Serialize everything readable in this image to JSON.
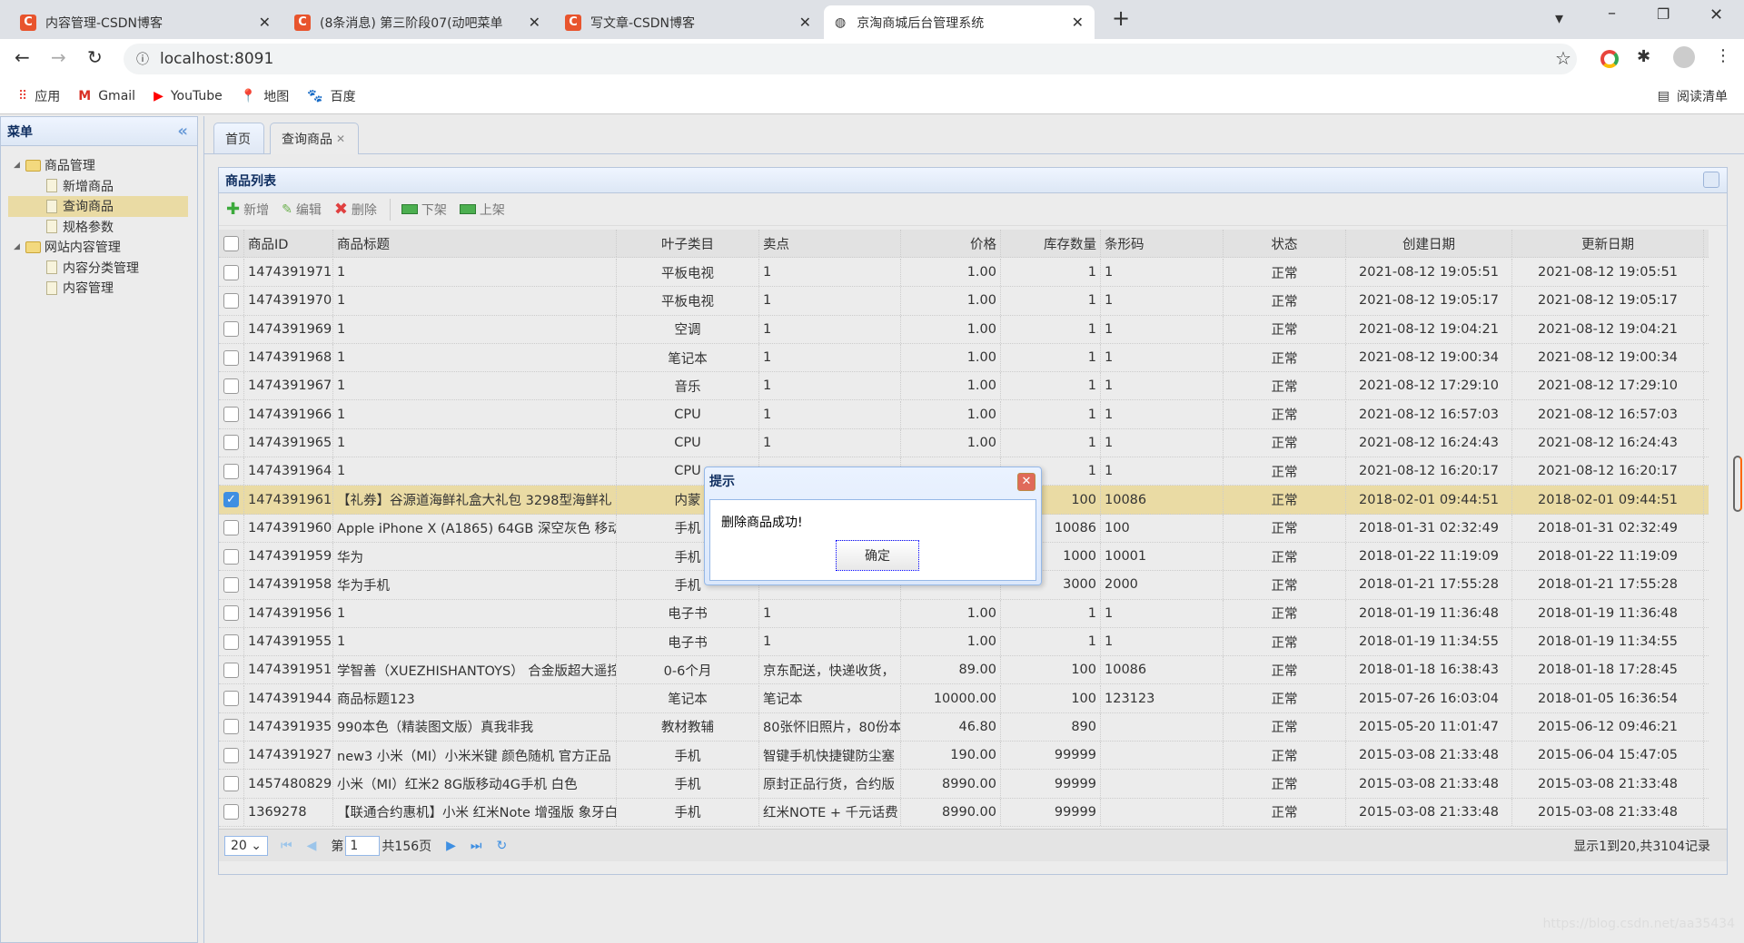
{
  "browser": {
    "tabs": [
      {
        "title": "内容管理-CSDN博客",
        "icon": "csdn-icon"
      },
      {
        "title": "(8条消息) 第三阶段07(动吧菜单",
        "icon": "csdn-icon"
      },
      {
        "title": "写文章-CSDN博客",
        "icon": "csdn-icon"
      },
      {
        "title": "京淘商城后台管理系统",
        "icon": "globe-icon"
      }
    ],
    "url": "localhost:8091",
    "bookmarks": [
      "应用",
      "Gmail",
      "YouTube",
      "地图",
      "百度"
    ],
    "reading_list": "阅读清单"
  },
  "sidebar": {
    "title": "菜单",
    "groups": [
      {
        "label": "商品管理",
        "items": [
          "新增商品",
          "查询商品",
          "规格参数"
        ]
      },
      {
        "label": "网站内容管理",
        "items": [
          "内容分类管理",
          "内容管理"
        ]
      }
    ],
    "selected": "查询商品"
  },
  "main_tabs": [
    "首页",
    "查询商品"
  ],
  "panel": {
    "title": "商品列表",
    "toolbar": [
      "新增",
      "编辑",
      "删除",
      "下架",
      "上架"
    ]
  },
  "grid": {
    "columns": [
      "商品ID",
      "商品标题",
      "叶子类目",
      "卖点",
      "价格",
      "库存数量",
      "条形码",
      "状态",
      "创建日期",
      "更新日期"
    ],
    "rows": [
      [
        "1474391971",
        "1",
        "平板电视",
        "1",
        "1.00",
        "1",
        "1",
        "正常",
        "2021-08-12 19:05:51",
        "2021-08-12 19:05:51"
      ],
      [
        "1474391970",
        "1",
        "平板电视",
        "1",
        "1.00",
        "1",
        "1",
        "正常",
        "2021-08-12 19:05:17",
        "2021-08-12 19:05:17"
      ],
      [
        "1474391969",
        "1",
        "空调",
        "1",
        "1.00",
        "1",
        "1",
        "正常",
        "2021-08-12 19:04:21",
        "2021-08-12 19:04:21"
      ],
      [
        "1474391968",
        "1",
        "笔记本",
        "1",
        "1.00",
        "1",
        "1",
        "正常",
        "2021-08-12 19:00:34",
        "2021-08-12 19:00:34"
      ],
      [
        "1474391967",
        "1",
        "音乐",
        "1",
        "1.00",
        "1",
        "1",
        "正常",
        "2021-08-12 17:29:10",
        "2021-08-12 17:29:10"
      ],
      [
        "1474391966",
        "1",
        "CPU",
        "1",
        "1.00",
        "1",
        "1",
        "正常",
        "2021-08-12 16:57:03",
        "2021-08-12 16:57:03"
      ],
      [
        "1474391965",
        "1",
        "CPU",
        "1",
        "1.00",
        "1",
        "1",
        "正常",
        "2021-08-12 16:24:43",
        "2021-08-12 16:24:43"
      ],
      [
        "1474391964",
        "1",
        "CPU",
        "",
        "",
        "1",
        "1",
        "正常",
        "2021-08-12 16:20:17",
        "2021-08-12 16:20:17"
      ],
      [
        "1474391961",
        "【礼券】谷源道海鲜礼盒大礼包 3298型海鲜礼",
        "内蒙",
        "",
        "",
        "100",
        "10086",
        "正常",
        "2018-02-01 09:44:51",
        "2018-02-01 09:44:51"
      ],
      [
        "1474391960",
        "Apple iPhone X (A1865) 64GB 深空灰色 移动",
        "手机",
        "",
        "",
        "10086",
        "100",
        "正常",
        "2018-01-31 02:32:49",
        "2018-01-31 02:32:49"
      ],
      [
        "1474391959",
        "华为",
        "手机",
        "",
        "",
        "1000",
        "10001",
        "正常",
        "2018-01-22 11:19:09",
        "2018-01-22 11:19:09"
      ],
      [
        "1474391958",
        "华为手机",
        "手机",
        "",
        "",
        "3000",
        "2000",
        "正常",
        "2018-01-21 17:55:28",
        "2018-01-21 17:55:28"
      ],
      [
        "1474391956",
        "1",
        "电子书",
        "1",
        "1.00",
        "1",
        "1",
        "正常",
        "2018-01-19 11:36:48",
        "2018-01-19 11:36:48"
      ],
      [
        "1474391955",
        "1",
        "电子书",
        "1",
        "1.00",
        "1",
        "1",
        "正常",
        "2018-01-19 11:34:55",
        "2018-01-19 11:34:55"
      ],
      [
        "1474391951",
        "学智善（XUEZHISHANTOYS） 合金版超大遥控",
        "0-6个月",
        "京东配送，快递收货，",
        "89.00",
        "100",
        "10086",
        "正常",
        "2018-01-18 16:38:43",
        "2018-01-18 17:28:45"
      ],
      [
        "1474391944",
        "商品标题123",
        "笔记本",
        "笔记本",
        "10000.00",
        "100",
        "123123",
        "正常",
        "2015-07-26 16:03:04",
        "2018-01-05 16:36:54"
      ],
      [
        "1474391935",
        "990本色（精装图文版）真我非我",
        "教材教辅",
        "80张怀旧照片，80份本",
        "46.80",
        "890",
        "",
        "正常",
        "2015-05-20 11:01:47",
        "2015-06-12 09:46:21"
      ],
      [
        "1474391927",
        "new3 小米（MI）小米米键 颜色随机 官方正品",
        "手机",
        "智键手机快捷键防尘塞",
        "190.00",
        "99999",
        "",
        "正常",
        "2015-03-08 21:33:48",
        "2015-06-04 15:47:05"
      ],
      [
        "1457480829",
        "小米（MI）红米2 8G版移动4G手机 白色",
        "手机",
        "原封正品行货，合约版",
        "8990.00",
        "99999",
        "",
        "正常",
        "2015-03-08 21:33:48",
        "2015-03-08 21:33:48"
      ],
      [
        "1369278",
        "【联通合约惠机】小米 红米Note 增强版 象牙白",
        "手机",
        "红米NOTE + 千元话费",
        "8990.00",
        "99999",
        "",
        "正常",
        "2015-03-08 21:33:48",
        "2015-03-08 21:33:48"
      ]
    ],
    "selected_row": 8
  },
  "pagination": {
    "page_size": "20",
    "page_label": "第",
    "page": "1",
    "total_pages": "共156页",
    "summary": "显示1到20,共3104记录"
  },
  "dialog": {
    "title": "提示",
    "message": "删除商品成功!",
    "ok": "确定"
  },
  "watermark": "https://blog.csdn.net/aa35434",
  "colors": {
    "selection": "#eadba4",
    "panel_border": "#b7c6dc",
    "header_text": "#0e2d5f",
    "checkbox_checked": "#3e8fe2"
  }
}
